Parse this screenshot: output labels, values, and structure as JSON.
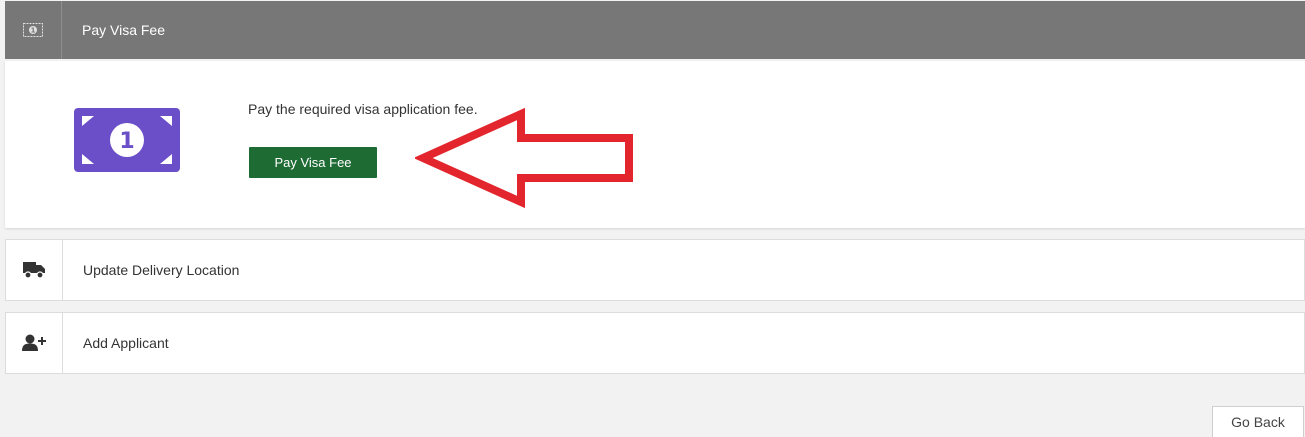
{
  "header": {
    "title": "Pay Visa Fee",
    "icon": "money-bill-icon"
  },
  "panel": {
    "description": "Pay the required visa application fee.",
    "pay_button_label": "Pay Visa Fee",
    "illustration_icon": "money-bill-icon",
    "illustration_color": "#6a4fc8",
    "button_color": "#1e6b34",
    "annotation": "red-arrow-pointing-left"
  },
  "rows": [
    {
      "label": "Update Delivery Location",
      "icon": "truck-icon"
    },
    {
      "label": "Add Applicant",
      "icon": "user-plus-icon"
    }
  ],
  "footer": {
    "go_back_label": "Go Back"
  }
}
